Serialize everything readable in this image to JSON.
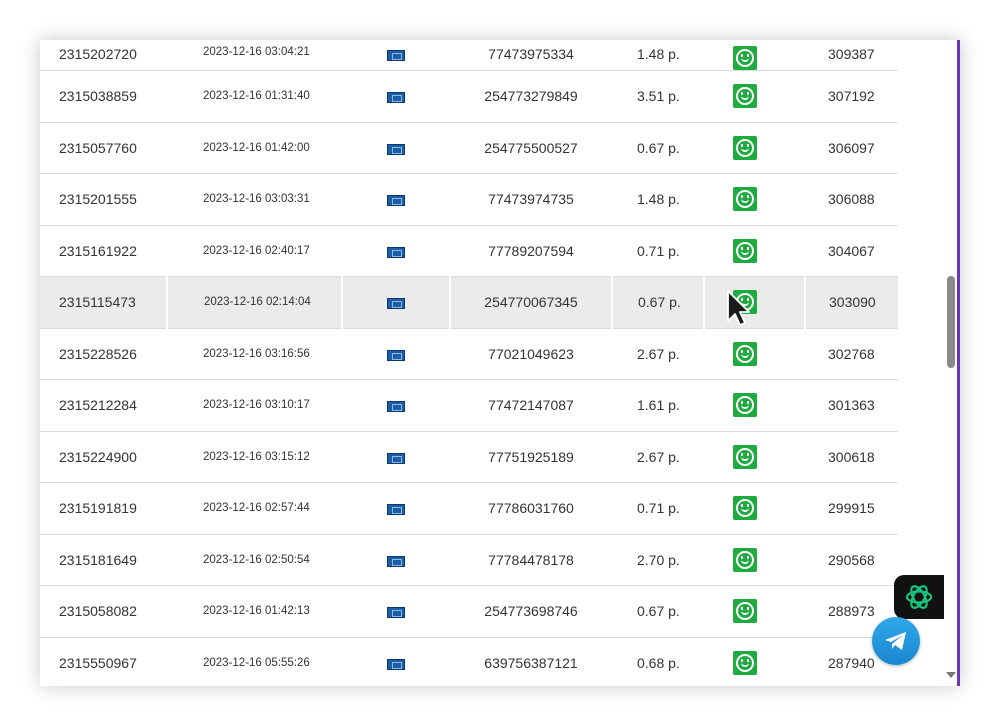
{
  "rows": [
    {
      "id": "2315202720",
      "date": "2023-12-16 03:04:21",
      "phone": "77473975334",
      "price": "1.48 р.",
      "num": "309387"
    },
    {
      "id": "2315038859",
      "date": "2023-12-16 01:31:40",
      "phone": "254773279849",
      "price": "3.51 р.",
      "num": "307192"
    },
    {
      "id": "2315057760",
      "date": "2023-12-16 01:42:00",
      "phone": "254775500527",
      "price": "0.67 р.",
      "num": "306097"
    },
    {
      "id": "2315201555",
      "date": "2023-12-16 03:03:31",
      "phone": "77473974735",
      "price": "1.48 р.",
      "num": "306088"
    },
    {
      "id": "2315161922",
      "date": "2023-12-16 02:40:17",
      "phone": "77789207594",
      "price": "0.71 р.",
      "num": "304067"
    },
    {
      "id": "2315115473",
      "date": "2023-12-16 02:14:04",
      "phone": "254770067345",
      "price": "0.67 р.",
      "num": "303090"
    },
    {
      "id": "2315228526",
      "date": "2023-12-16 03:16:56",
      "phone": "77021049623",
      "price": "2.67 р.",
      "num": "302768"
    },
    {
      "id": "2315212284",
      "date": "2023-12-16 03:10:17",
      "phone": "77472147087",
      "price": "1.61 р.",
      "num": "301363"
    },
    {
      "id": "2315224900",
      "date": "2023-12-16 03:15:12",
      "phone": "77751925189",
      "price": "2.67 р.",
      "num": "300618"
    },
    {
      "id": "2315191819",
      "date": "2023-12-16 02:57:44",
      "phone": "77786031760",
      "price": "0.71 р.",
      "num": "299915"
    },
    {
      "id": "2315181649",
      "date": "2023-12-16 02:50:54",
      "phone": "77784478178",
      "price": "2.70 р.",
      "num": "290568"
    },
    {
      "id": "2315058082",
      "date": "2023-12-16 01:42:13",
      "phone": "254773698746",
      "price": "0.67 р.",
      "num": "288973"
    },
    {
      "id": "2315550967",
      "date": "2023-12-16 05:55:26",
      "phone": "639756387121",
      "price": "0.68 р.",
      "num": "287940"
    }
  ],
  "highlight_row": 5,
  "icons": {
    "flag": "flag-icon",
    "status": "smile-icon",
    "ai": "openai-logo-icon",
    "telegram": "telegram-icon",
    "cursor": "mouse-cursor-icon"
  },
  "colors": {
    "status_green": "#1faa3f",
    "edge_purple": "#6b35b3",
    "telegram_blue": "#2aa3e6"
  }
}
